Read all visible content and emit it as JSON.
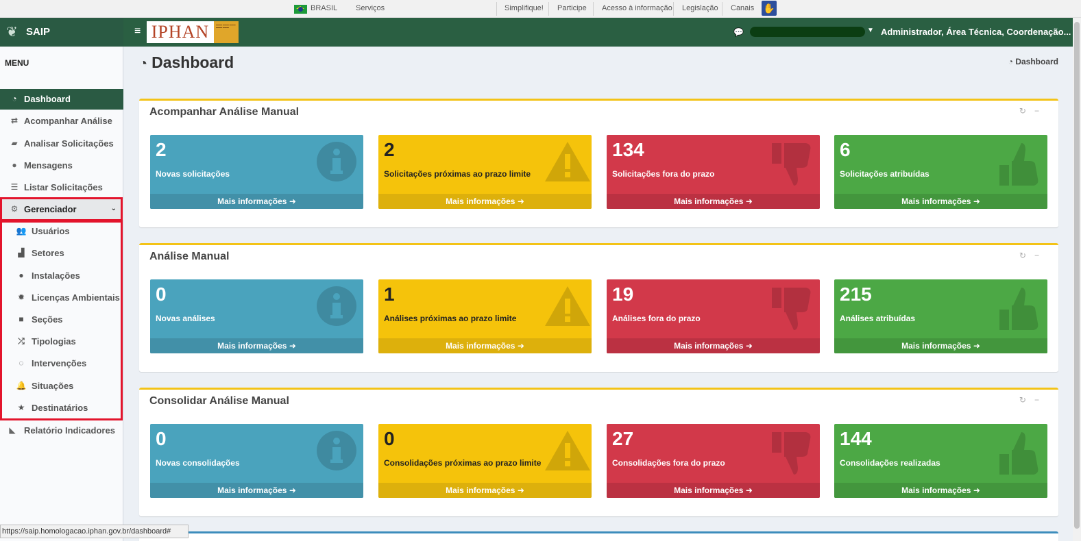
{
  "govbar": {
    "brasil": "BRASIL",
    "servicos": "Serviços",
    "links": [
      "Simplifique!",
      "Participe",
      "Acesso à informação",
      "Legislação",
      "Canais"
    ]
  },
  "app": {
    "name": "SAIP",
    "brand": "IPHAN"
  },
  "header": {
    "user": "Administrador, Área Técnica, Coordenação..."
  },
  "sidebar": {
    "menu_label": "MENU",
    "items": [
      {
        "label": "Dashboard",
        "icon": "dashboard-icon"
      },
      {
        "label": "Acompanhar Análise",
        "icon": "exchange-icon"
      },
      {
        "label": "Analisar Solicitações",
        "icon": "book-icon"
      },
      {
        "label": "Mensagens",
        "icon": "comments-icon"
      },
      {
        "label": "Listar Solicitações",
        "icon": "list-icon"
      },
      {
        "label": "Gerenciador",
        "icon": "cogs-icon"
      }
    ],
    "subitems": [
      {
        "label": "Usuários",
        "icon": "users-icon"
      },
      {
        "label": "Setores",
        "icon": "industry-icon"
      },
      {
        "label": "Instalações",
        "icon": "circle-icon"
      },
      {
        "label": "Licenças Ambientais",
        "icon": "certificate-icon"
      },
      {
        "label": "Seções",
        "icon": "square-icon"
      },
      {
        "label": "Tipologias",
        "icon": "random-icon"
      },
      {
        "label": "Intervenções",
        "icon": "circle-notch-icon"
      },
      {
        "label": "Situações",
        "icon": "bell-icon"
      },
      {
        "label": "Destinatários",
        "icon": "star-icon"
      }
    ],
    "last_item": {
      "label": "Relatório Indicadores",
      "icon": "area-chart-icon"
    }
  },
  "page": {
    "title": "Dashboard",
    "breadcrumb": "Dashboard"
  },
  "more_info": "Mais informações",
  "sections": [
    {
      "title": "Acompanhar Análise Manual",
      "tiles": [
        {
          "value": "2",
          "label": "Novas solicitações"
        },
        {
          "value": "2",
          "label": "Solicitações próximas ao prazo limite"
        },
        {
          "value": "134",
          "label": "Solicitações fora do prazo"
        },
        {
          "value": "6",
          "label": "Solicitações atribuídas"
        }
      ]
    },
    {
      "title": "Análise Manual",
      "tiles": [
        {
          "value": "0",
          "label": "Novas análises"
        },
        {
          "value": "1",
          "label": "Análises próximas ao prazo limite"
        },
        {
          "value": "19",
          "label": "Análises fora do prazo"
        },
        {
          "value": "215",
          "label": "Análises atribuídas"
        }
      ]
    },
    {
      "title": "Consolidar Análise Manual",
      "tiles": [
        {
          "value": "0",
          "label": "Novas consolidações"
        },
        {
          "value": "0",
          "label": "Consolidações próximas ao prazo limite"
        },
        {
          "value": "27",
          "label": "Consolidações fora do prazo"
        },
        {
          "value": "144",
          "label": "Consolidações realizadas"
        }
      ]
    }
  ],
  "status_url": "https://saip.homologacao.iphan.gov.br/dashboard#",
  "colors": {
    "header_green": "#2a5f42",
    "aqua": "#4aa3bd",
    "yellow": "#f5c30b",
    "red": "#d2394a",
    "green": "#4ca845",
    "highlight": "#e3142c"
  }
}
